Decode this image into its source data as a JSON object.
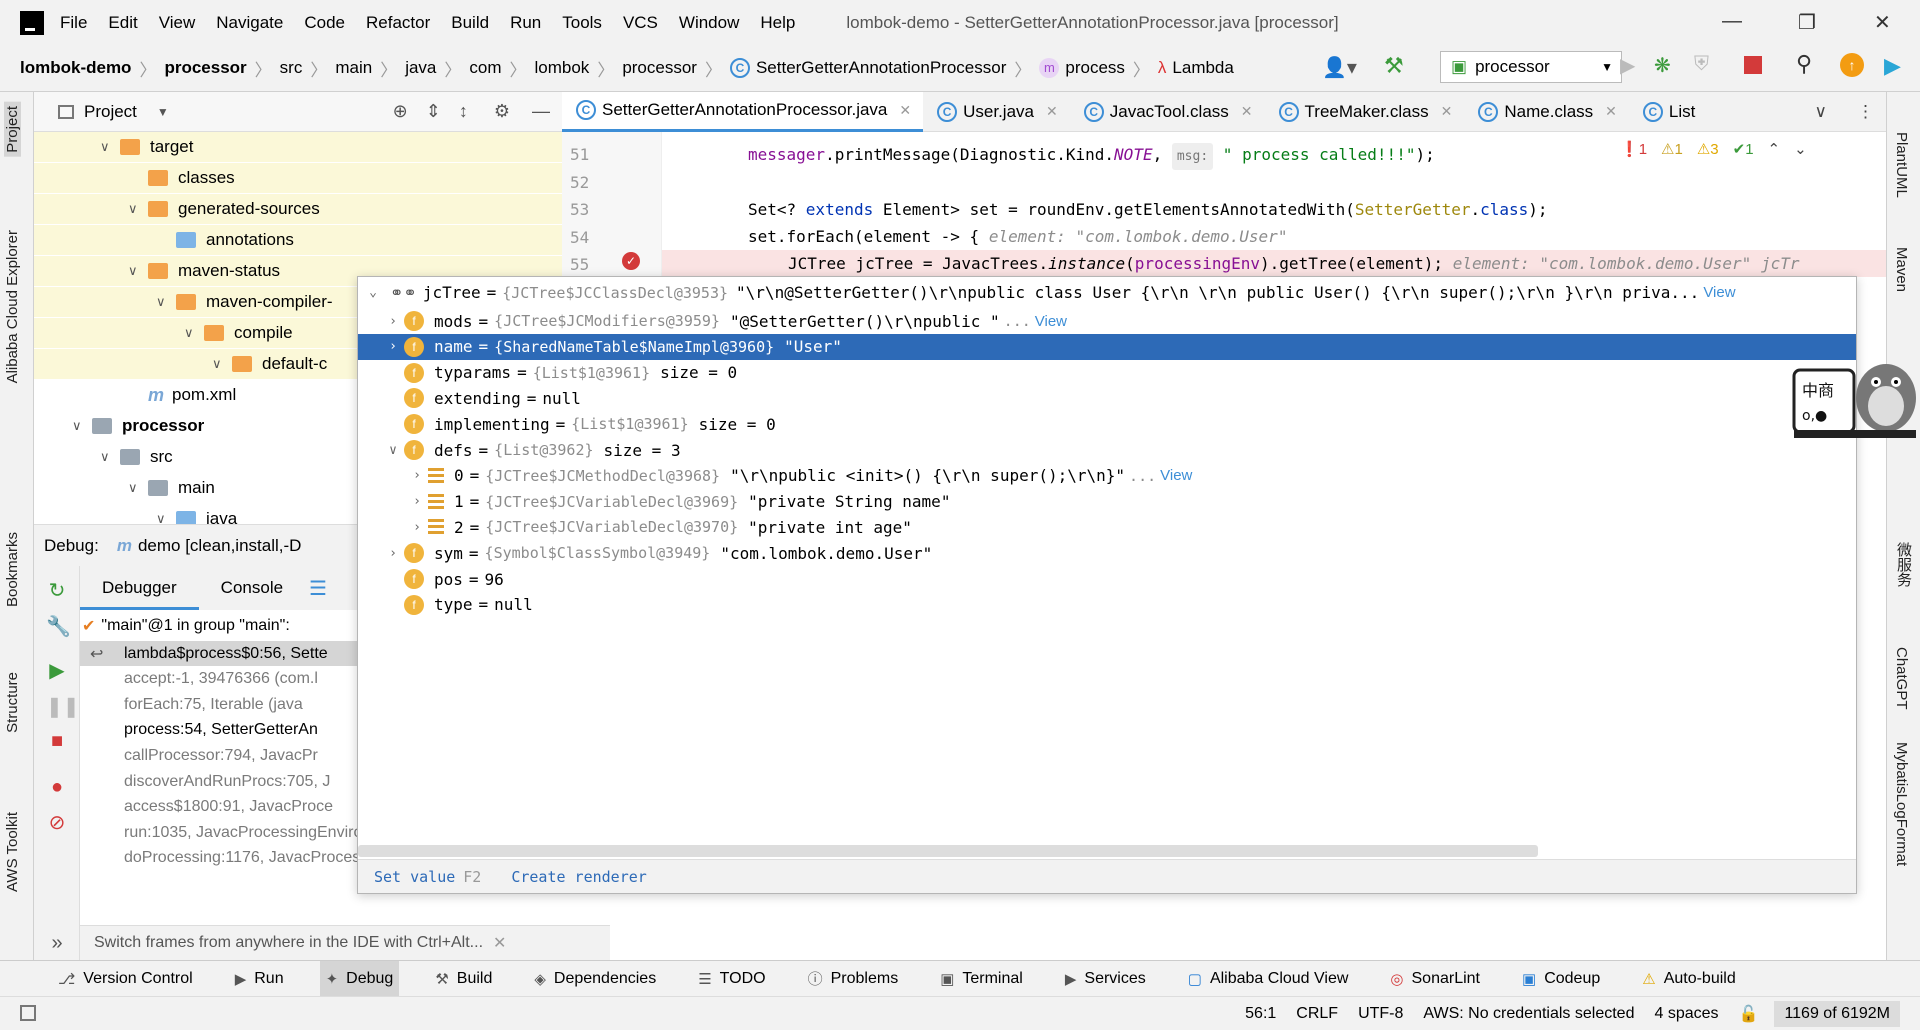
{
  "window": {
    "title": "lombok-demo - SetterGetterAnnotationProcessor.java [processor]"
  },
  "menu": [
    "File",
    "Edit",
    "View",
    "Navigate",
    "Code",
    "Refactor",
    "Build",
    "Run",
    "Tools",
    "VCS",
    "Window",
    "Help"
  ],
  "breadcrumb": [
    "lombok-demo",
    "processor",
    "src",
    "main",
    "java",
    "com",
    "lombok",
    "processor"
  ],
  "breadcrumb_class": "SetterGetterAnnotationProcessor",
  "breadcrumb_method": "process",
  "breadcrumb_lambda": "Lambda",
  "run_config": "processor",
  "project": {
    "header": "Project"
  },
  "tree": [
    {
      "label": "target",
      "depth": 2,
      "type": "folder",
      "arrow": "open"
    },
    {
      "label": "classes",
      "depth": 3,
      "type": "folder",
      "arrow": ""
    },
    {
      "label": "generated-sources",
      "depth": 3,
      "type": "folder",
      "arrow": "open"
    },
    {
      "label": "annotations",
      "depth": 4,
      "type": "folder-blue",
      "arrow": ""
    },
    {
      "label": "maven-status",
      "depth": 3,
      "type": "folder",
      "arrow": "open"
    },
    {
      "label": "maven-compiler-",
      "depth": 4,
      "type": "folder",
      "arrow": "open"
    },
    {
      "label": "compile",
      "depth": 5,
      "type": "folder",
      "arrow": "open"
    },
    {
      "label": "default-c",
      "depth": 6,
      "type": "folder",
      "arrow": "open"
    },
    {
      "label": "pom.xml",
      "depth": 3,
      "type": "maven",
      "arrow": ""
    },
    {
      "label": "processor",
      "depth": 1,
      "type": "module",
      "arrow": "open"
    },
    {
      "label": "src",
      "depth": 2,
      "type": "folder-grey",
      "arrow": "open"
    },
    {
      "label": "main",
      "depth": 3,
      "type": "folder-grey",
      "arrow": "open"
    },
    {
      "label": "java",
      "depth": 4,
      "type": "folder-blue",
      "arrow": "open"
    }
  ],
  "debug": {
    "label": "Debug:",
    "config": "demo [clean,install,-D",
    "tabs": [
      "Debugger",
      "Console"
    ],
    "thread": "\"main\"@1 in group \"main\":",
    "frames": [
      {
        "text": "lambda$process$0:56, Sette",
        "state": "sel"
      },
      {
        "text": "accept:-1, 39476366 (com.l",
        "state": "lib"
      },
      {
        "text": "forEach:75, Iterable (java",
        "state": "lib"
      },
      {
        "text": "process:54, SetterGetterAn",
        "state": "cur"
      },
      {
        "text": "callProcessor:794, JavacPr",
        "state": "lib"
      },
      {
        "text": "discoverAndRunProcs:705, J",
        "state": "lib"
      },
      {
        "text": "access$1800:91, JavacProce",
        "state": "lib"
      },
      {
        "text": "run:1035, JavacProcessingEnvironment$Round (com.sun.too",
        "state": "lib"
      },
      {
        "text": "doProcessing:1176, JavacProcessingEnvironment (com.sun",
        "state": "lib"
      }
    ],
    "hint": "Switch frames from anywhere in the IDE with Ctrl+Alt..."
  },
  "editor": {
    "tabs": [
      {
        "label": "SetterGetterAnnotationProcessor.java",
        "active": true
      },
      {
        "label": "User.java",
        "active": false
      },
      {
        "label": "JavacTool.class",
        "active": false
      },
      {
        "label": "TreeMaker.class",
        "active": false
      },
      {
        "label": "Name.class",
        "active": false
      },
      {
        "label": "List",
        "active": false
      }
    ],
    "line_numbers": [
      "51",
      "52",
      "53",
      "54",
      "55"
    ],
    "inspections": {
      "errors": "1",
      "warnings": "1",
      "weak": "3",
      "ok": "1"
    }
  },
  "popup": {
    "root": {
      "name": "jcTree",
      "type": "{JCTree$JCClassDecl@3953}",
      "value": "\"\\r\\n@SetterGetter()\\r\\npublic class User {\\r\\n    \\r\\n    public User() {\\r\\n        super();\\r\\n    }\\r\\n    priva...",
      "view": "View"
    },
    "rows": [
      {
        "name": "mods",
        "type": "{JCTree$JCModifiers@3959}",
        "value": "\"@SetterGetter()\\r\\npublic \"",
        "more": "...",
        "view": "View",
        "expandable": true,
        "depth": 1,
        "icon": "f"
      },
      {
        "name": "name",
        "type": "{SharedNameTable$NameImpl@3960}",
        "value": "\"User\"",
        "expandable": true,
        "depth": 1,
        "icon": "f",
        "selected": true
      },
      {
        "name": "typarams",
        "type": "{List$1@3961}",
        "value": "size = 0",
        "depth": 1,
        "icon": "f"
      },
      {
        "name": "extending",
        "type": "",
        "value": "null",
        "depth": 1,
        "icon": "f"
      },
      {
        "name": "implementing",
        "type": "{List$1@3961}",
        "value": "size = 0",
        "depth": 1,
        "icon": "f"
      },
      {
        "name": "defs",
        "type": "{List@3962}",
        "value": "size = 3",
        "expandable": true,
        "expanded": true,
        "depth": 1,
        "icon": "f"
      },
      {
        "name": "0",
        "type": "{JCTree$JCMethodDecl@3968}",
        "value": "\"\\r\\npublic <init>() {\\r\\n    super();\\r\\n}\"",
        "more": "...",
        "view": "View",
        "expandable": true,
        "depth": 2,
        "icon": "list"
      },
      {
        "name": "1",
        "type": "{JCTree$JCVariableDecl@3969}",
        "value": "\"private String name\"",
        "expandable": true,
        "depth": 2,
        "icon": "list"
      },
      {
        "name": "2",
        "type": "{JCTree$JCVariableDecl@3970}",
        "value": "\"private int age\"",
        "expandable": true,
        "depth": 2,
        "icon": "list"
      },
      {
        "name": "sym",
        "type": "{Symbol$ClassSymbol@3949}",
        "value": "\"com.lombok.demo.User\"",
        "expandable": true,
        "depth": 1,
        "icon": "f"
      },
      {
        "name": "pos",
        "type": "",
        "value": "96",
        "depth": 1,
        "icon": "f"
      },
      {
        "name": "type",
        "type": "",
        "value": "null",
        "depth": 1,
        "icon": "f"
      }
    ],
    "set_value": "Set value",
    "set_value_key": "F2",
    "create_renderer": "Create renderer"
  },
  "left_tabs": [
    "Project",
    "Alibaba Cloud Explorer",
    "Bookmarks",
    "Structure",
    "AWS Toolkit"
  ],
  "right_tabs": [
    "PlantUML",
    "Maven",
    "微服务",
    "ChatGPT",
    "MybatisLogFormat"
  ],
  "toolwindows": [
    "Version Control",
    "Run",
    "Debug",
    "Build",
    "Dependencies",
    "TODO",
    "Problems",
    "Terminal",
    "Services",
    "Alibaba Cloud View",
    "SonarLint",
    "Codeup",
    "Auto-build"
  ],
  "status": {
    "position": "56:1",
    "line_sep": "CRLF",
    "encoding": "UTF-8",
    "aws": "AWS: No credentials selected",
    "indent": "4 spaces",
    "memory": "1169 of 6192M"
  },
  "colors": {
    "accent": "#2d6ab7",
    "breakpoint": "#d33a3a",
    "selection": "#2d6ab7",
    "highlight": "#fbf8d8"
  }
}
